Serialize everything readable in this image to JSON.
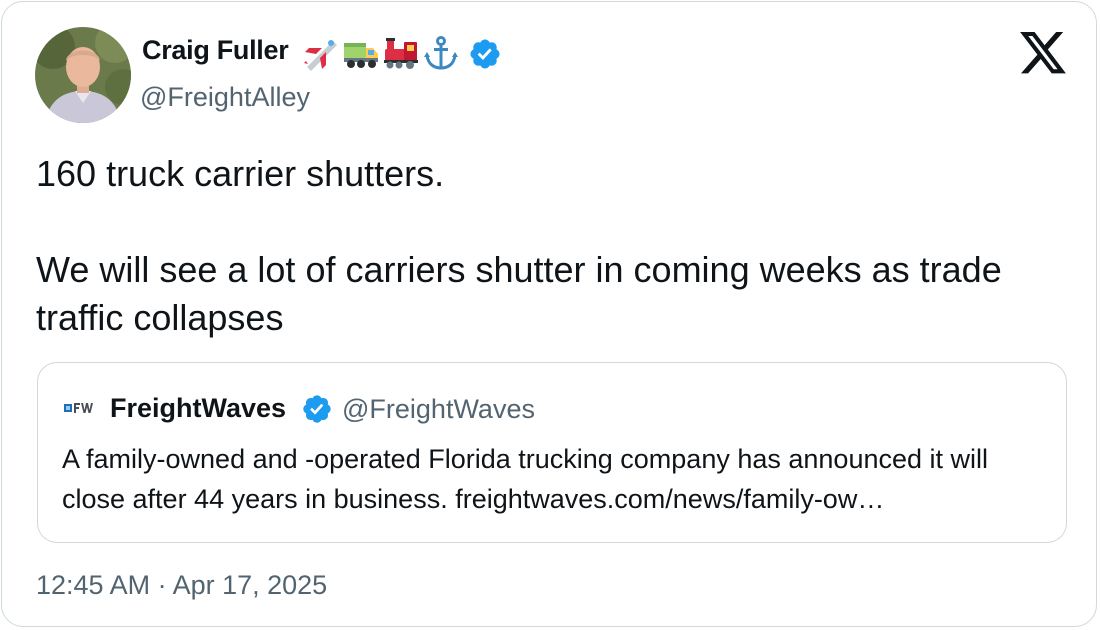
{
  "author": {
    "name": "Craig Fuller",
    "handle": "@FreightAlley",
    "name_emojis": [
      "airplane-icon",
      "truck-icon",
      "train-icon",
      "anchor-icon"
    ],
    "verified": true
  },
  "tweet": {
    "text": "160 truck carrier shutters.\n\nWe will see a lot of carriers shutter in coming weeks as trade traffic collapses",
    "timestamp": "12:45 AM · Apr 17, 2025"
  },
  "quoted_tweet": {
    "author_name": "FreightWaves",
    "author_handle": "@FreightWaves",
    "verified": true,
    "text": "A family-owned and -operated Florida trucking company has announced it will close after 44 years in business. freightwaves.com/news/family-ow…"
  },
  "colors": {
    "text": "#0f1419",
    "secondary": "#536471",
    "border": "#cfd9de",
    "verified": "#1d9bf0"
  }
}
